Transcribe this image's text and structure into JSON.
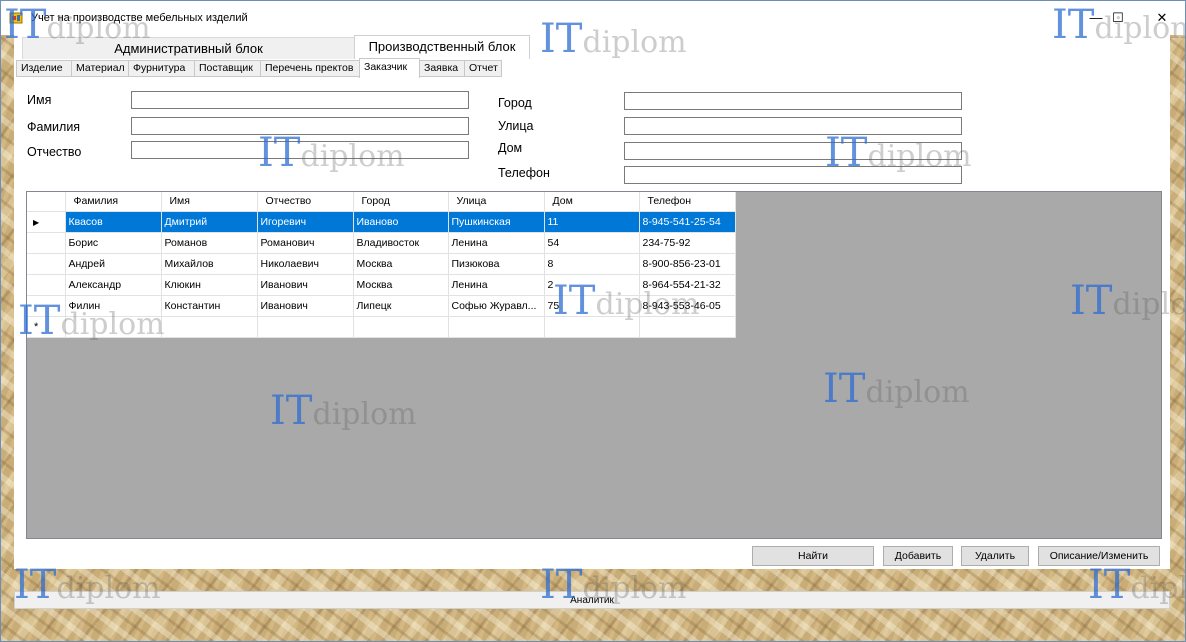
{
  "window": {
    "title": "Учет на производстве мебельных изделий",
    "minimize": "—",
    "maximize": "☐",
    "close": "✕"
  },
  "top_tabs": {
    "admin": "Административный блок",
    "production": "Производственный блок"
  },
  "sub_tabs": [
    "Изделие",
    "Материал",
    "Фурнитура",
    "Поставщик",
    "Перечень пректов",
    "Заказчик",
    "Заявка",
    "Отчет"
  ],
  "active_sub_tab": "Заказчик",
  "form": {
    "name_label": "Имя",
    "surname_label": "Фамилия",
    "patronymic_label": "Отчество",
    "city_label": "Город",
    "street_label": "Улица",
    "house_label": "Дом",
    "phone_label": "Телефон",
    "name_value": "",
    "surname_value": "",
    "patronymic_value": "",
    "city_value": "",
    "street_value": "",
    "house_value": "",
    "phone_value": ""
  },
  "grid": {
    "columns": [
      "Фамилия",
      "Имя",
      "Отчество",
      "Город",
      "Улица",
      "Дом",
      "Телефон"
    ],
    "rows": [
      [
        "Квасов",
        "Дмитрий",
        "Игоревич",
        "Иваново",
        "Пушкинская",
        "11",
        "8-945-541-25-54"
      ],
      [
        "Борис",
        "Романов",
        "Романович",
        "Владивосток",
        "Ленина",
        "54",
        "234-75-92"
      ],
      [
        "Андрей",
        "Михайлов",
        "Николаевич",
        "Москва",
        "Пизюкова",
        "8",
        "8-900-856-23-01"
      ],
      [
        "Александр",
        "Клюкин",
        "Иванович",
        "Москва",
        "Ленина",
        "2",
        "8-964-554-21-32"
      ],
      [
        "Филин",
        "Константин",
        "Иванович",
        "Липецк",
        "Софью Журавл...",
        "75",
        "8-943-553-46-05"
      ]
    ],
    "selected_row_marker": "▶",
    "new_row_marker": "*"
  },
  "buttons": {
    "find": "Найти",
    "add": "Добавить",
    "delete": "Удалить",
    "describe_edit": "Описание/Изменить"
  },
  "status": {
    "label": "Аналитик"
  },
  "watermark": {
    "part_a": "IT",
    "part_b": "diplom"
  }
}
